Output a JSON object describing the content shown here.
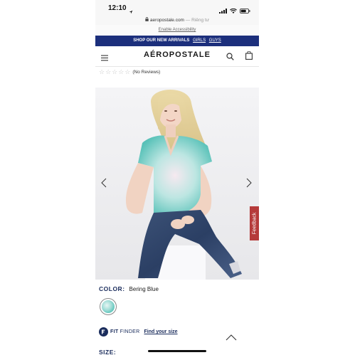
{
  "status_bar": {
    "time": "12:10"
  },
  "browser": {
    "url": "aeropostale.com",
    "url_suffix": "— Riêng tư"
  },
  "accessibility_link": "Enable Accessibility",
  "promo": {
    "text": "SHOP OUR NEW ARRIVALS",
    "links": [
      "GIRLS",
      "GUYS"
    ],
    "background": "#1c2f7c"
  },
  "header": {
    "logo": "AÉROPOSTALE"
  },
  "rating": {
    "stars_filled": 0,
    "stars_total": 5,
    "label": "(No Reviews)"
  },
  "feedback": {
    "label": "Feedback",
    "color": "#b53a3a"
  },
  "product": {
    "color_label": "COLOR:",
    "color_value": "Bering Blue",
    "swatch_color": "#6fcac1",
    "fit_finder": {
      "brand": "FIT",
      "suffix": "FINDER",
      "link": "Find your size"
    },
    "size_label": "SIZE:"
  },
  "icons": {
    "menu": "hamburger-menu-icon",
    "search": "search-icon",
    "bag": "shopping-bag-icon",
    "prev": "chevron-left-icon",
    "next": "chevron-right-icon",
    "collapse": "chevron-up-icon"
  }
}
